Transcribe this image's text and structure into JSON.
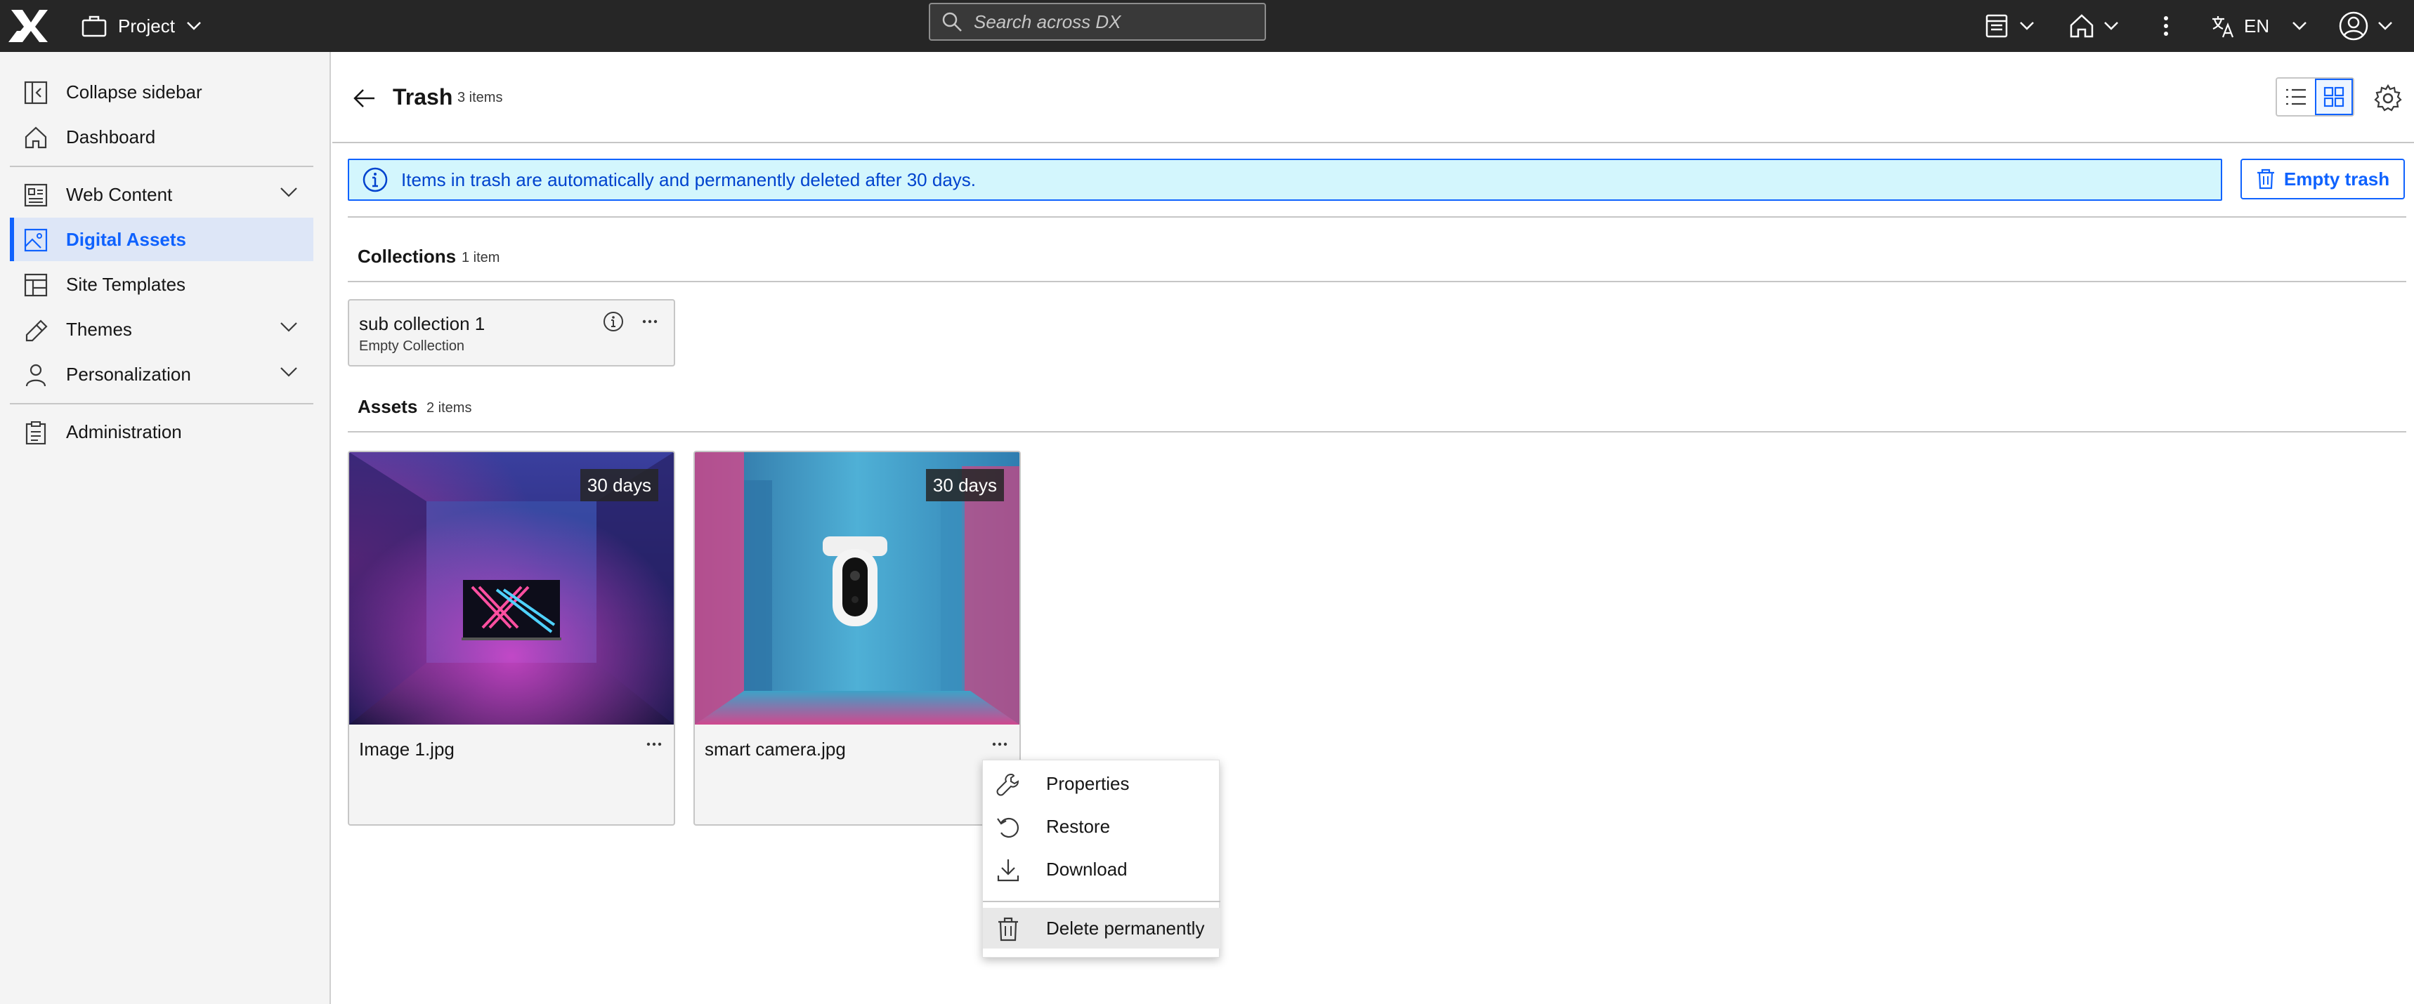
{
  "topbar": {
    "project_label": "Project",
    "search_placeholder": "Search across DX",
    "language": "EN"
  },
  "sidebar": {
    "items": [
      {
        "label": "Collapse sidebar",
        "icon": "collapse-sidebar-icon"
      },
      {
        "label": "Dashboard",
        "icon": "home-icon"
      },
      {
        "label": "Web Content",
        "icon": "web-content-icon",
        "expandable": true
      },
      {
        "label": "Digital Assets",
        "icon": "image-icon",
        "active": true
      },
      {
        "label": "Site Templates",
        "icon": "template-icon"
      },
      {
        "label": "Themes",
        "icon": "paint-brush-icon",
        "expandable": true
      },
      {
        "label": "Personalization",
        "icon": "user-icon",
        "expandable": true
      },
      {
        "label": "Administration",
        "icon": "clipboard-icon"
      }
    ]
  },
  "page": {
    "title": "Trash",
    "count": "3 items"
  },
  "banner": {
    "message": "Items in trash are automatically and permanently deleted after 30 days.",
    "empty_trash_label": "Empty trash"
  },
  "collections": {
    "title": "Collections",
    "count": "1 item",
    "items": [
      {
        "name": "sub collection 1",
        "subtitle": "Empty Collection"
      }
    ]
  },
  "assets": {
    "title": "Assets",
    "count": "2 items",
    "items": [
      {
        "name": "Image 1.jpg",
        "badge": "30 days"
      },
      {
        "name": "smart camera.jpg",
        "badge": "30 days"
      }
    ]
  },
  "context_menu": {
    "items": [
      {
        "label": "Properties",
        "icon": "wrench-icon"
      },
      {
        "label": "Restore",
        "icon": "restore-icon"
      },
      {
        "label": "Download",
        "icon": "download-icon"
      },
      {
        "label": "Delete permanently",
        "icon": "trash-icon"
      }
    ]
  },
  "colors": {
    "topbar": "#262626",
    "accent": "#0f62fe",
    "banner_bg": "#d3f6fd",
    "sidebar_bg": "#f4f4f4"
  }
}
